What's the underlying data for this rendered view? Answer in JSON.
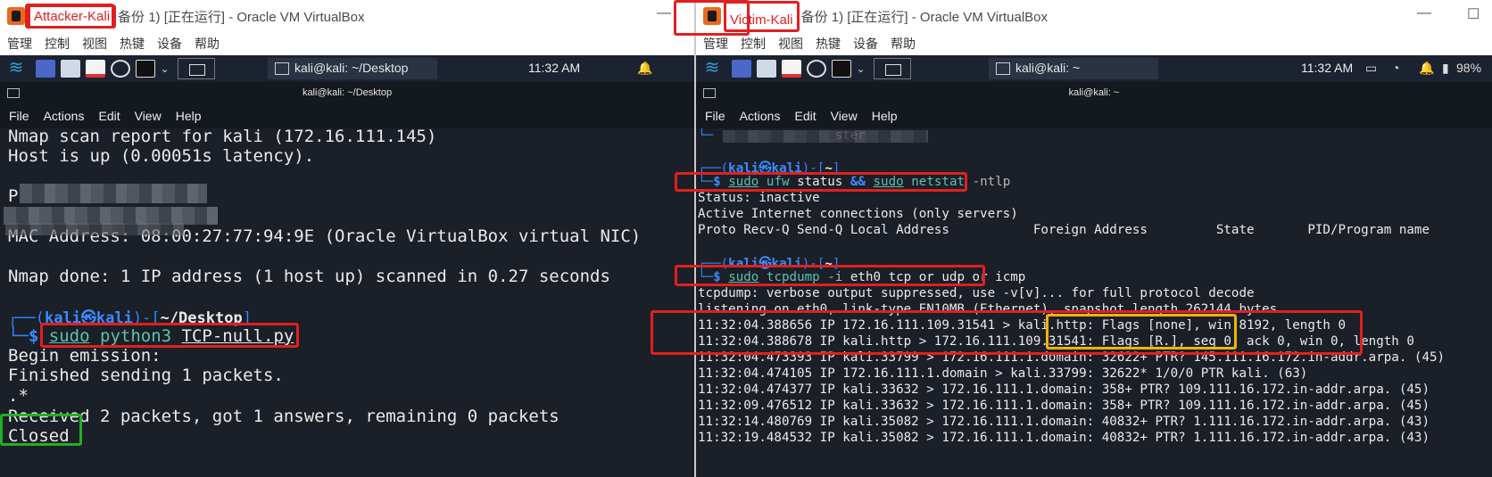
{
  "left": {
    "vm_name": "Attacker-Kali",
    "title_rest": "备份 1) [正在运行] - Oracle VM VirtualBox",
    "vm_menu": [
      "管理",
      "控制",
      "视图",
      "热键",
      "设备",
      "帮助"
    ],
    "task_label": "kali@kali: ~/Desktop",
    "clock": "11:32 AM",
    "term_title": "kali@kali: ~/Desktop",
    "term_menu": [
      "File",
      "Actions",
      "Edit",
      "View",
      "Help"
    ],
    "lines": {
      "l1": "Nmap scan report for kali (172.16.111.145)",
      "l2": "Host is up (0.00051s latency).",
      "l3": "P",
      "l4": "MAC Address: 08:00:27:77:94:9E (Oracle VirtualBox virtual NIC)",
      "l5": "Nmap done: 1 IP address (1 host up) scanned in 0.27 seconds",
      "p_user": "kali",
      "p_host": "kali",
      "p_dir": "~/Desktop",
      "c_sudo": "sudo",
      "c_py": "python3",
      "c_file": "TCP-null.py",
      "o1": "Begin emission:",
      "o2": "Finished sending 1 packets.",
      "o3": ".*",
      "o4": "Received 2 packets, got 1 answers, remaining 0 packets",
      "o5": "Closed"
    }
  },
  "right": {
    "vm_name": "Victim-Kali",
    "title_rest": "备份 1) [正在运行] - Oracle VM VirtualBox",
    "vm_menu": [
      "管理",
      "控制",
      "视图",
      "热键",
      "设备",
      "帮助"
    ],
    "task_label": "kali@kali: ~",
    "clock": "11:32 AM",
    "battery": "98%",
    "term_title": "kali@kali: ~",
    "term_menu": [
      "File",
      "Actions",
      "Edit",
      "View",
      "Help"
    ],
    "lines": {
      "top": "└─",
      "top_t": "ster",
      "p_user": "kali",
      "p_host": "kali",
      "p_dir": "~",
      "c1_sudo": "sudo",
      "c1_a": "ufw",
      "c1_b": "status",
      "c1_and": "&&",
      "c1_sudo2": "sudo",
      "c1_c": "netstat",
      "c1_d": "-ntlp",
      "s1": "Status: inactive",
      "s2": "Active Internet connections (only servers)",
      "s3": "Proto Recv-Q Send-Q Local Address           Foreign Address         State       PID/Program name",
      "c2_sudo": "sudo",
      "c2_a": "tcpdump",
      "c2_b": "-i",
      "c2_rest": " eth0 tcp or udp or icmp",
      "t1": "tcpdump: verbose output suppressed, use -v[v]... for full protocol decode",
      "t2": "listening on eth0, link-type EN10MB (Ethernet), snapshot length 262144 bytes",
      "t3": "11:32:04.388656 IP 172.16.111.109.31541 > kali.http: Flags [none], win 8192, length 0",
      "t4": "11:32:04.388678 IP kali.http > 172.16.111.109.31541: Flags [R.], seq 0, ack 0, win 0, length 0",
      "t5": "11:32:04.473393 IP kali.33799 > 172.16.111.1.domain: 32622+ PTR? 145.111.16.172.in-addr.arpa. (45)",
      "t6": "11:32:04.474105 IP 172.16.111.1.domain > kali.33799: 32622* 1/0/0 PTR kali. (63)",
      "t7": "11:32:04.474377 IP kali.33632 > 172.16.111.1.domain: 358+ PTR? 109.111.16.172.in-addr.arpa. (45)",
      "t8": "11:32:09.476512 IP kali.33632 > 172.16.111.1.domain: 358+ PTR? 109.111.16.172.in-addr.arpa. (45)",
      "t9": "11:32:14.480769 IP kali.35082 > 172.16.111.1.domain: 40832+ PTR? 1.111.16.172.in-addr.arpa. (43)",
      "t10": "11:32:19.484532 IP kali.35082 > 172.16.111.1.domain: 40832+ PTR? 1.111.16.172.in-addr.arpa. (43)"
    }
  }
}
